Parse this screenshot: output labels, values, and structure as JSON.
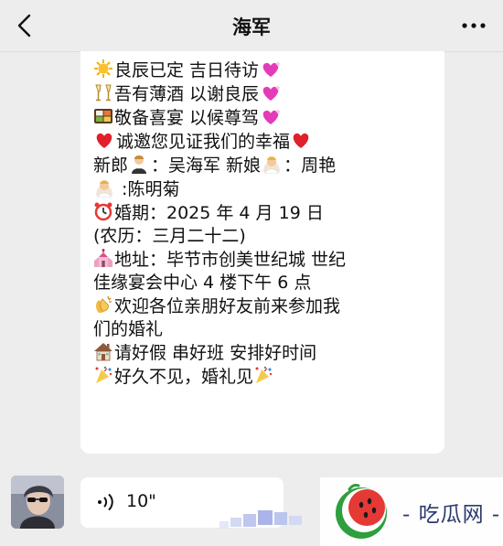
{
  "header": {
    "title": "海军",
    "back_icon": "chevron-left-icon",
    "more_icon": "more-icon"
  },
  "message": {
    "lines": [
      "良辰已定 吉日待访",
      "吾有薄酒 以谢良辰",
      "敬备喜宴 以候尊驾",
      "诚邀您见证我们的幸福",
      "新郎",
      "：吴海军 新娘",
      "：周艳",
      ":陈明菊",
      "婚期：2025 年 4 月 19 日",
      "(农历：三月二十二)",
      "地址：毕节市创美世纪城 世纪",
      "佳缘宴会中心 4 楼下午 6 点",
      "欢迎各位亲朋好友前来参加我",
      "们的婚礼",
      "请好假 串好班 安排好时间",
      "好久不见，婚礼见"
    ],
    "emoji_icons": [
      "sun-icon",
      "champagne-icon",
      "bento-icon",
      "sparkling-heart-icon",
      "red-heart-icon",
      "groom-icon",
      "bride-icon",
      "alarm-clock-icon",
      "wedding-chapel-icon",
      "clapping-hands-icon",
      "house-icon",
      "confetti-ball-icon"
    ]
  },
  "voice_message": {
    "duration": "10\"",
    "icon": "voice-wave-icon"
  },
  "watermark": {
    "text": "- 吃瓜网 -",
    "logo_icon": "watermelon-logo-icon"
  },
  "colors": {
    "background": "#ededed",
    "bubble": "#ffffff",
    "heart": "#e0202a",
    "pink_heart": "#e43bb8",
    "watermark_text": "#2b3a6d"
  }
}
